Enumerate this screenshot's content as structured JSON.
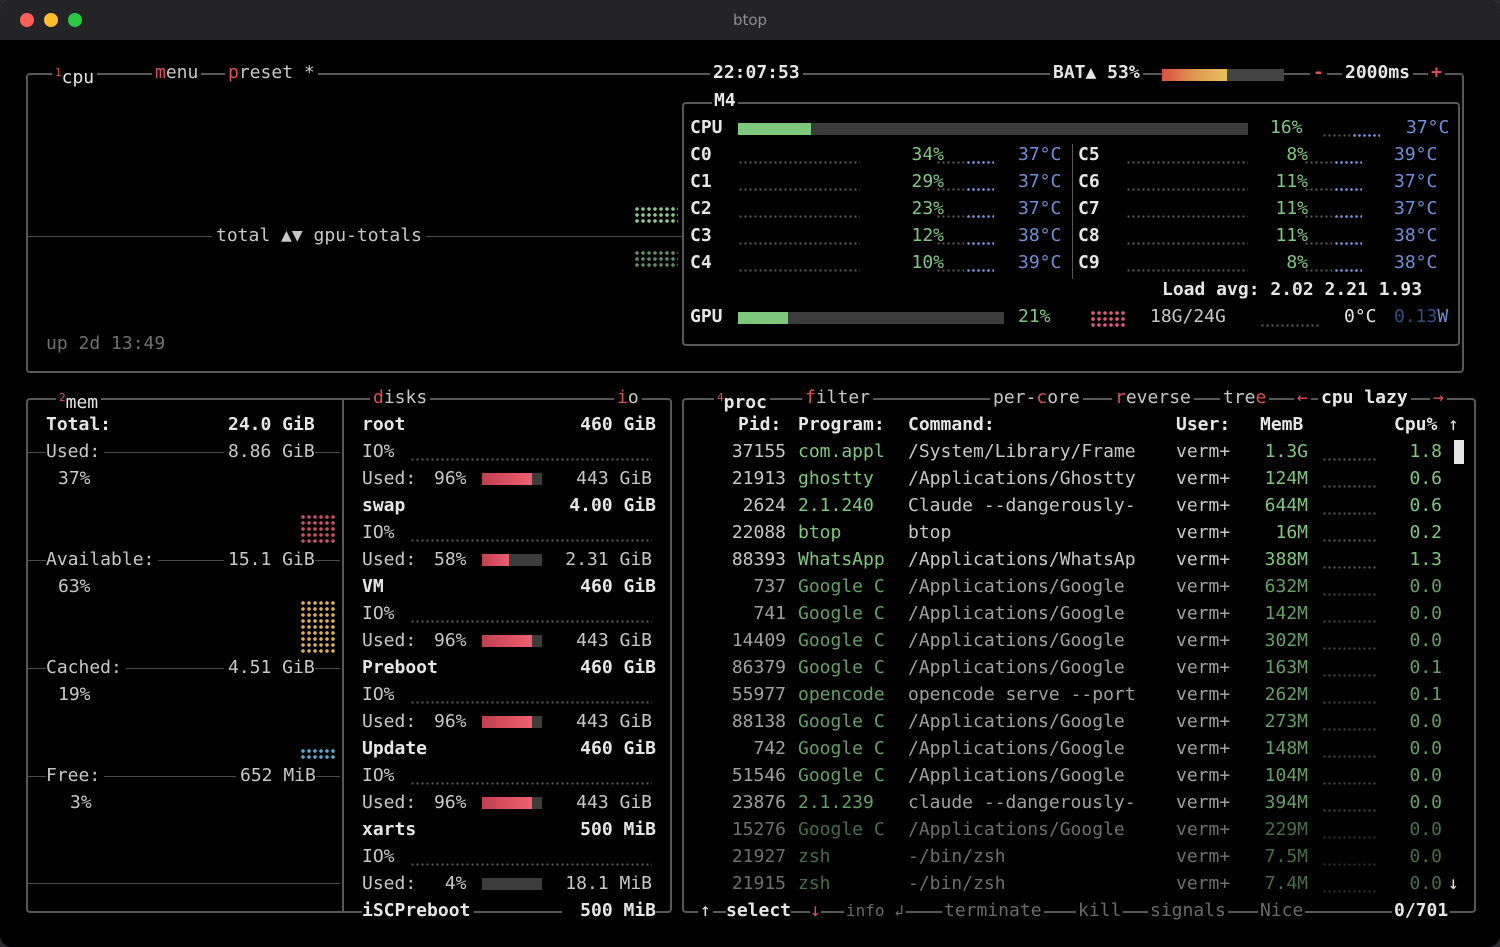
{
  "window": {
    "title": "btop"
  },
  "colors": {
    "accent": "#e05050",
    "green": "#7ec87e",
    "temp": "#6f8fd8",
    "gray": "#8a8a8a"
  },
  "top": {
    "cpu_tab_num": "1",
    "cpu_tab": "cpu",
    "menu_first": "m",
    "menu_rest": "enu",
    "preset_first": "p",
    "preset_rest": "reset *",
    "clock": "22:07:53",
    "battery_label": "BAT▲ 53%",
    "battery_percent": 53,
    "minus": "-",
    "refresh": "2000ms",
    "plus": "+",
    "graph_label": "total ▲▼ gpu-totals",
    "uptime": "up 2d 13:49"
  },
  "cpu": {
    "model": "M4",
    "label": "CPU",
    "total_pct": "16%",
    "total_value": 16,
    "total_temp": "37°C",
    "cores_left": [
      {
        "name": "C0",
        "pct": "34%",
        "temp": "37°C"
      },
      {
        "name": "C1",
        "pct": "29%",
        "temp": "37°C"
      },
      {
        "name": "C2",
        "pct": "23%",
        "temp": "37°C"
      },
      {
        "name": "C3",
        "pct": "12%",
        "temp": "38°C"
      },
      {
        "name": "C4",
        "pct": "10%",
        "temp": "39°C"
      }
    ],
    "cores_right": [
      {
        "name": "C5",
        "pct": "8%",
        "temp": "39°C"
      },
      {
        "name": "C6",
        "pct": "11%",
        "temp": "37°C"
      },
      {
        "name": "C7",
        "pct": "11%",
        "temp": "37°C"
      },
      {
        "name": "C8",
        "pct": "11%",
        "temp": "38°C"
      },
      {
        "name": "C9",
        "pct": "8%",
        "temp": "38°C"
      }
    ],
    "load_avg": "Load avg: 2.02 2.21 1.93",
    "gpu_label": "GPU",
    "gpu_pct": "21%",
    "gpu_value": 21,
    "gpu_mem": "18G/24G",
    "gpu_temp": "0°C",
    "gpu_power_dim": "0.13",
    "gpu_power_unit": "W"
  },
  "mem": {
    "num": "2",
    "title": "mem",
    "total_label": "Total:",
    "total_value": "24.0 GiB",
    "used_label": "Used:",
    "used_value": "8.86 GiB",
    "used_pct": "37%",
    "available_label": "Available:",
    "available_value": "15.1 GiB",
    "available_pct": "63%",
    "cached_label": "Cached:",
    "cached_value": "4.51 GiB",
    "cached_pct": "19%",
    "free_label": "Free:",
    "free_value": "652 MiB",
    "free_pct": "3%"
  },
  "disks": {
    "title_first": "d",
    "title_rest": "isks",
    "io_first": "i",
    "io_rest": "o",
    "io_label": "IO%",
    "used_label": "Used:",
    "items": [
      {
        "name": "root",
        "size": "460 GiB",
        "used_pct": "96%",
        "used_value": 96,
        "used": "443 GiB"
      },
      {
        "name": "swap",
        "size": "4.00 GiB",
        "used_pct": "58%",
        "used_value": 58,
        "used": "2.31 GiB"
      },
      {
        "name": "VM",
        "size": "460 GiB",
        "used_pct": "96%",
        "used_value": 96,
        "used": "443 GiB"
      },
      {
        "name": "Preboot",
        "size": "460 GiB",
        "used_pct": "96%",
        "used_value": 96,
        "used": "443 GiB"
      },
      {
        "name": "Update",
        "size": "460 GiB",
        "used_pct": "96%",
        "used_value": 96,
        "used": "443 GiB"
      },
      {
        "name": "xarts",
        "size": "500 MiB",
        "used_pct": " 4%",
        "used_value": 4,
        "used": "18.1 MiB"
      },
      {
        "name": "iSCPreboot",
        "size": "500 MiB"
      }
    ]
  },
  "proc": {
    "num": "4",
    "title": "proc",
    "filter_first": "f",
    "filter_rest": "ilter",
    "percore_a": "per-",
    "percore_c": "c",
    "percore_b": "ore",
    "reverse_first": "r",
    "reverse_rest": "everse",
    "tree_a": "tre",
    "tree_e": "e",
    "left_arrow": "←",
    "sort": "cpu lazy",
    "right_arrow": "→",
    "headers": {
      "pid": "Pid:",
      "program": "Program:",
      "command": "Command:",
      "user": "User:",
      "mem": "MemB",
      "cpu": "Cpu%"
    },
    "up_arrow": "↑",
    "down_arrow": "↓",
    "rows": [
      {
        "pid": "37155",
        "program": "com.appl",
        "command": "/System/Library/Frame",
        "user": "verm+",
        "mem": "1.3G",
        "cpu": "1.8"
      },
      {
        "pid": "21913",
        "program": "ghostty",
        "command": "/Applications/Ghostty",
        "user": "verm+",
        "mem": "124M",
        "cpu": "0.6"
      },
      {
        "pid": "2624",
        "program": "2.1.240",
        "command": "Claude --dangerously-",
        "user": "verm+",
        "mem": "644M",
        "cpu": "0.6"
      },
      {
        "pid": "22088",
        "program": "btop",
        "command": "btop",
        "user": "verm+",
        "mem": "16M",
        "cpu": "0.2"
      },
      {
        "pid": "88393",
        "program": "WhatsApp",
        "command": "/Applications/WhatsAp",
        "user": "verm+",
        "mem": "388M",
        "cpu": "1.3"
      },
      {
        "pid": "737",
        "program": "Google C",
        "command": "/Applications/Google",
        "user": "verm+",
        "mem": "632M",
        "cpu": "0.0"
      },
      {
        "pid": "741",
        "program": "Google C",
        "command": "/Applications/Google",
        "user": "verm+",
        "mem": "142M",
        "cpu": "0.0"
      },
      {
        "pid": "14409",
        "program": "Google C",
        "command": "/Applications/Google",
        "user": "verm+",
        "mem": "302M",
        "cpu": "0.0"
      },
      {
        "pid": "86379",
        "program": "Google C",
        "command": "/Applications/Google",
        "user": "verm+",
        "mem": "163M",
        "cpu": "0.1"
      },
      {
        "pid": "55977",
        "program": "opencode",
        "command": "opencode serve --port",
        "user": "verm+",
        "mem": "262M",
        "cpu": "0.1"
      },
      {
        "pid": "88138",
        "program": "Google C",
        "command": "/Applications/Google",
        "user": "verm+",
        "mem": "273M",
        "cpu": "0.0"
      },
      {
        "pid": "742",
        "program": "Google C",
        "command": "/Applications/Google",
        "user": "verm+",
        "mem": "148M",
        "cpu": "0.0"
      },
      {
        "pid": "51546",
        "program": "Google C",
        "command": "/Applications/Google",
        "user": "verm+",
        "mem": "104M",
        "cpu": "0.0"
      },
      {
        "pid": "23876",
        "program": "2.1.239",
        "command": "claude --dangerously-",
        "user": "verm+",
        "mem": "394M",
        "cpu": "0.0"
      },
      {
        "pid": "15276",
        "program": "Google C",
        "command": "/Applications/Google",
        "user": "verm+",
        "mem": "229M",
        "cpu": "0.0"
      },
      {
        "pid": "21927",
        "program": "zsh",
        "command": "-/bin/zsh",
        "user": "verm+",
        "mem": "7.5M",
        "cpu": "0.0"
      },
      {
        "pid": "21915",
        "program": "zsh",
        "command": "-/bin/zsh",
        "user": "verm+",
        "mem": "7.4M",
        "cpu": "0.0"
      }
    ],
    "footer": {
      "select": "select",
      "info": "info ↲",
      "terminate": "terminate",
      "kill": "kill",
      "signals": "signals",
      "nice": "Nice",
      "count": "0/701"
    }
  }
}
